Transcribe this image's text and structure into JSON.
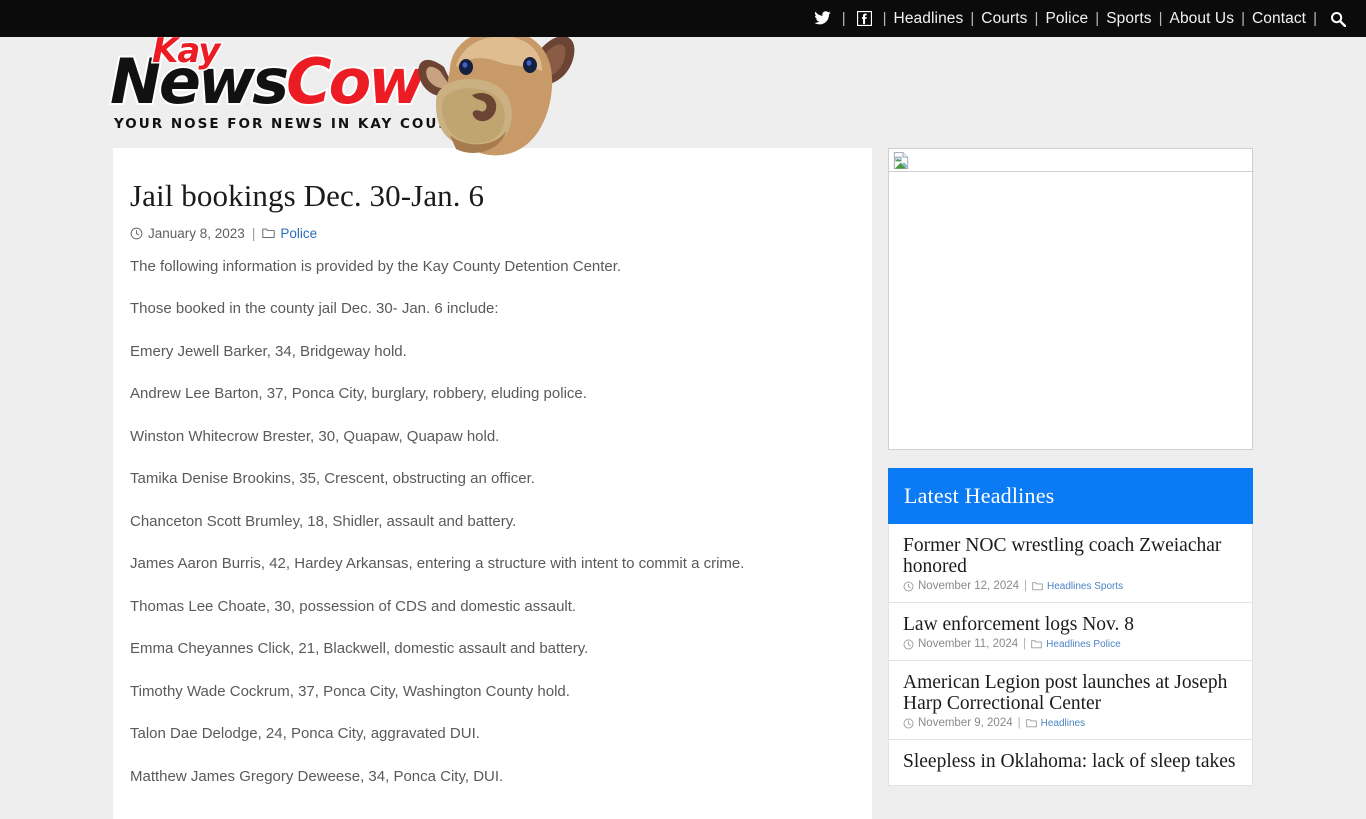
{
  "topnav": {
    "items": [
      {
        "type": "icon",
        "name": "twitter-icon",
        "label": ""
      },
      {
        "type": "sep",
        "label": "|"
      },
      {
        "type": "icon",
        "name": "facebook-icon",
        "label": ""
      },
      {
        "type": "sep",
        "label": "|"
      },
      {
        "type": "link",
        "name": "nav-headlines",
        "label": "Headlines"
      },
      {
        "type": "sep",
        "label": "|"
      },
      {
        "type": "link",
        "name": "nav-courts",
        "label": "Courts"
      },
      {
        "type": "sep",
        "label": "|"
      },
      {
        "type": "link",
        "name": "nav-police",
        "label": "Police"
      },
      {
        "type": "sep",
        "label": "|"
      },
      {
        "type": "link",
        "name": "nav-sports",
        "label": "Sports"
      },
      {
        "type": "sep",
        "label": "|"
      },
      {
        "type": "link",
        "name": "nav-about-us",
        "label": "About Us"
      },
      {
        "type": "sep",
        "label": "|"
      },
      {
        "type": "link",
        "name": "nav-contact",
        "label": "Contact"
      },
      {
        "type": "sep",
        "label": "|"
      },
      {
        "type": "icon",
        "name": "search-icon",
        "label": ""
      }
    ]
  },
  "logo": {
    "kay": "Kay",
    "news": "News",
    "cow": "Cow",
    "tagline": "YOUR NOSE FOR NEWS IN KAY COUNTY",
    "red": "#ec1c24",
    "dark": "#111111"
  },
  "article": {
    "title": "Jail bookings Dec. 30-Jan. 6",
    "date": "January 8, 2023",
    "meta_separator": "|",
    "category": "Police",
    "paragraphs": [
      "The following information is provided by the Kay County Detention Center.",
      "Those booked in the county jail  Dec. 30- Jan. 6 include:",
      "Emery Jewell Barker, 34, Bridgeway hold.",
      "Andrew Lee Barton, 37, Ponca City, burglary, robbery, eluding police.",
      "Winston Whitecrow Brester, 30, Quapaw, Quapaw hold.",
      "Tamika Denise Brookins, 35, Crescent, obstructing an officer.",
      "Chanceton Scott Brumley, 18, Shidler, assault and battery.",
      "James Aaron Burris, 42, Hardey Arkansas, entering a structure with intent to commit a crime.",
      "Thomas Lee Choate, 30, possession of CDS and domestic assault.",
      "Emma Cheyannes Click, 21, Blackwell, domestic assault and battery.",
      "Timothy Wade Cockrum, 37, Ponca City, Washington County hold.",
      "Talon Dae Delodge, 24, Ponca City, aggravated DUI.",
      "Matthew James Gregory Deweese, 34, Ponca City, DUI."
    ]
  },
  "sidebar": {
    "ad": {
      "alt": ""
    },
    "widget": {
      "title": "Latest Headlines",
      "accent": "#0b7bf5",
      "headlines": [
        {
          "title": "Former NOC wrestling coach Zweiachar honored",
          "date": "November 12, 2024",
          "separator": "|",
          "category": "Headlines Sports"
        },
        {
          "title": "Law enforcement logs Nov. 8",
          "date": "November 11, 2024",
          "separator": "|",
          "category": "Headlines Police"
        },
        {
          "title": "American Legion post launches at Joseph Harp Correctional Center",
          "date": "November 9, 2024",
          "separator": "|",
          "category": "Headlines"
        },
        {
          "title": "Sleepless in Oklahoma: lack of sleep takes",
          "date": "",
          "separator": "",
          "category": ""
        }
      ]
    }
  }
}
